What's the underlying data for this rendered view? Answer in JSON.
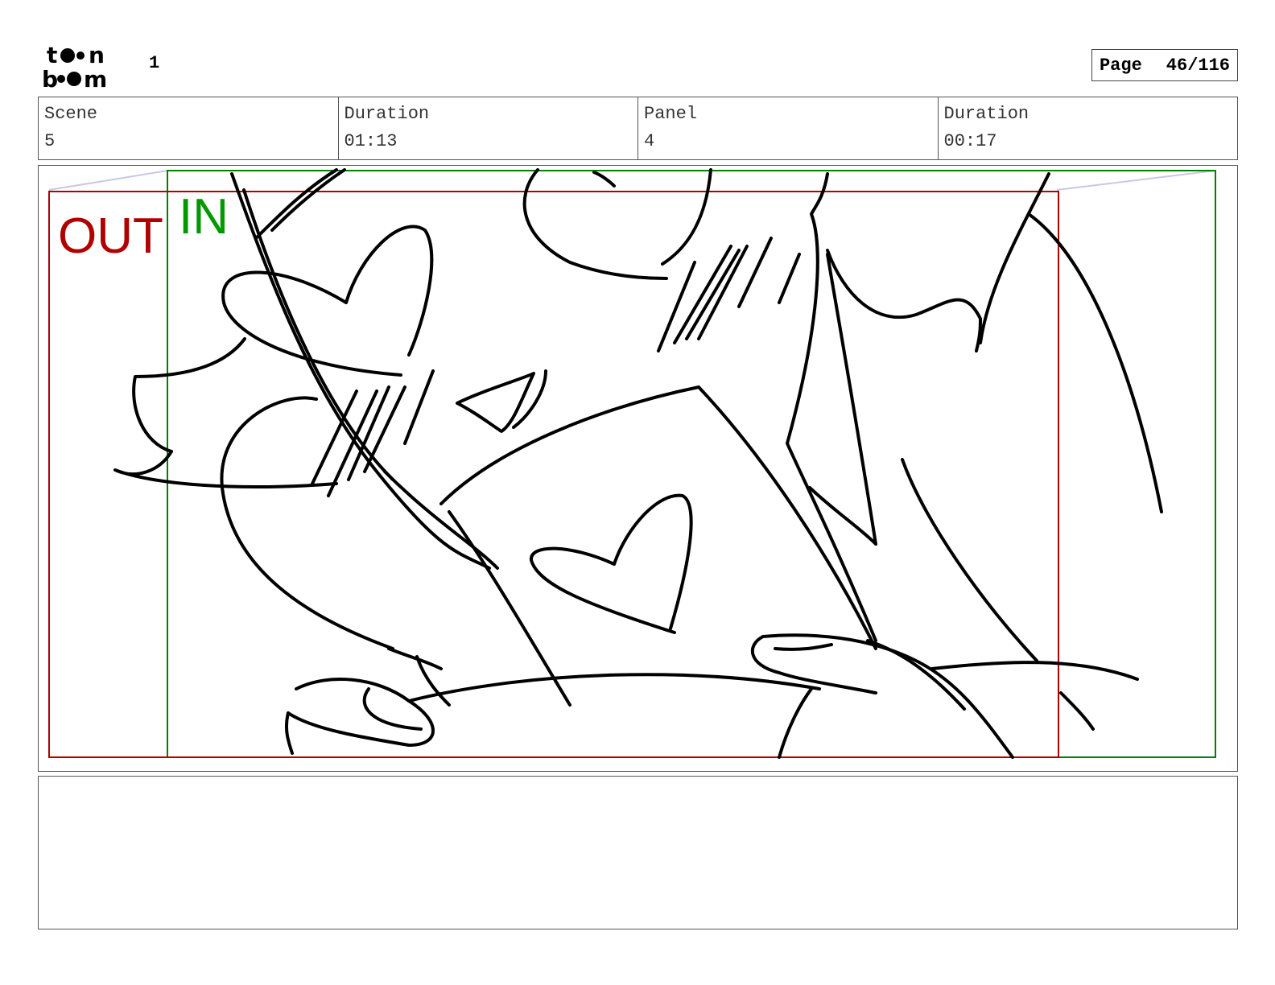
{
  "header": {
    "logo_text": "toon boom",
    "sheet_number": "1",
    "page_label": "Page",
    "page_value": "46/116"
  },
  "info": {
    "scene_label": "Scene",
    "scene_value": "5",
    "scene_duration_label": "Duration",
    "scene_duration_value": "01:13",
    "panel_label": "Panel",
    "panel_value": "4",
    "panel_duration_label": "Duration",
    "panel_duration_value": "00:17"
  },
  "panel": {
    "out_label": "OUT",
    "in_label": "IN",
    "out_color": "#b00000",
    "in_color": "#008000"
  },
  "caption": {
    "text": ""
  }
}
